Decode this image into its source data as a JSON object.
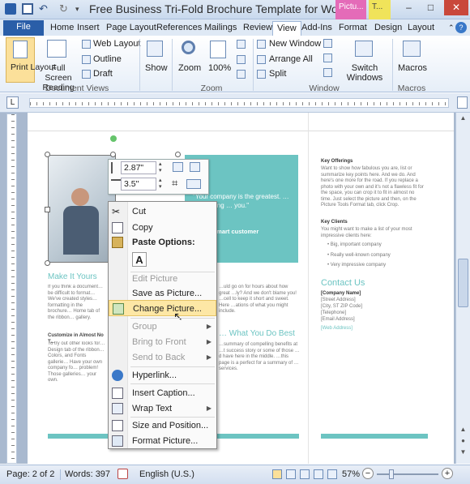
{
  "window": {
    "title": "Free Business Tri-Fold Brochure Template for Word",
    "context_tab_1": "Pictu...",
    "context_tab_2": "T...",
    "minimize": "–",
    "maximize": "□",
    "close": "✕"
  },
  "tabs": [
    "File",
    "Home",
    "Insert",
    "Page Layout",
    "References",
    "Mailings",
    "Review",
    "View",
    "Add-Ins",
    "Format",
    "Design",
    "Layout"
  ],
  "active_tab": "View",
  "ribbon": {
    "document_views": {
      "label": "Document Views",
      "print_layout": "Print Layout",
      "full_screen_reading": "Full Screen Reading",
      "web_layout": "Web Layout",
      "outline": "Outline",
      "draft": "Draft"
    },
    "show": {
      "label": "Show"
    },
    "zoom": {
      "label": "Zoom",
      "zoom": "Zoom",
      "hundred": "100%"
    },
    "window": {
      "label": "Window",
      "new_window": "New Window",
      "arrange_all": "Arrange All",
      "split": "Split",
      "switch_windows": "Switch Windows"
    },
    "macros": {
      "label": "Macros",
      "macros": "Macros"
    }
  },
  "mini_toolbar": {
    "height": "2.87\"",
    "width": "3.5\""
  },
  "context_menu": {
    "items": [
      {
        "label": "Cut",
        "icon": "scissors-icon",
        "disabled": false
      },
      {
        "label": "Copy",
        "icon": "copy-icon",
        "disabled": false
      },
      {
        "label": "Paste Options:",
        "icon": "paste-icon",
        "disabled": false
      },
      {
        "label": "Edit Picture",
        "disabled": true
      },
      {
        "label": "Save as Picture...",
        "disabled": false
      },
      {
        "label": "Change Picture...",
        "icon": "change-picture-icon",
        "disabled": false,
        "highlighted": true
      },
      {
        "label": "Group",
        "disabled": true
      },
      {
        "label": "Bring to Front",
        "disabled": true
      },
      {
        "label": "Send to Back",
        "disabled": true
      },
      {
        "label": "Hyperlink...",
        "icon": "hyperlink-icon",
        "disabled": false
      },
      {
        "label": "Insert Caption...",
        "icon": "caption-icon",
        "disabled": false
      },
      {
        "label": "Wrap Text",
        "icon": "wrap-text-icon",
        "disabled": false
      },
      {
        "label": "Size and Position...",
        "icon": "size-position-icon",
        "disabled": false
      },
      {
        "label": "Format Picture...",
        "icon": "format-picture-icon",
        "disabled": false
      }
    ],
    "paste_option": "A"
  },
  "document": {
    "quote": "\"Your company is the greatest. … … … living … you.\"",
    "quote_attr": "- … Smart customer",
    "make_it_yours": "Make It Yours",
    "what_you_do_best": "… What You Do Best",
    "contact_us": "Contact Us",
    "key_offerings": "Key Offerings",
    "key_clients": "Key Clients",
    "clients": [
      "Big, important company",
      "Really well-known company",
      "Very impressive company"
    ],
    "contact_lines": [
      "[Company Name]",
      "[Street Address]",
      "[City, ST ZIP Code]",
      "[Telephone]",
      "[Email Address]",
      "[Web Address]"
    ],
    "customize_heading": "Customize in Almost No T…"
  },
  "status": {
    "page": "Page: 2 of 2",
    "words": "Words: 397",
    "language": "English (U.S.)",
    "zoom": "57%"
  },
  "colors": {
    "accent": "#6cc4c2",
    "file_tab": "#2a5ea8",
    "highlight": "#fde7a5"
  }
}
